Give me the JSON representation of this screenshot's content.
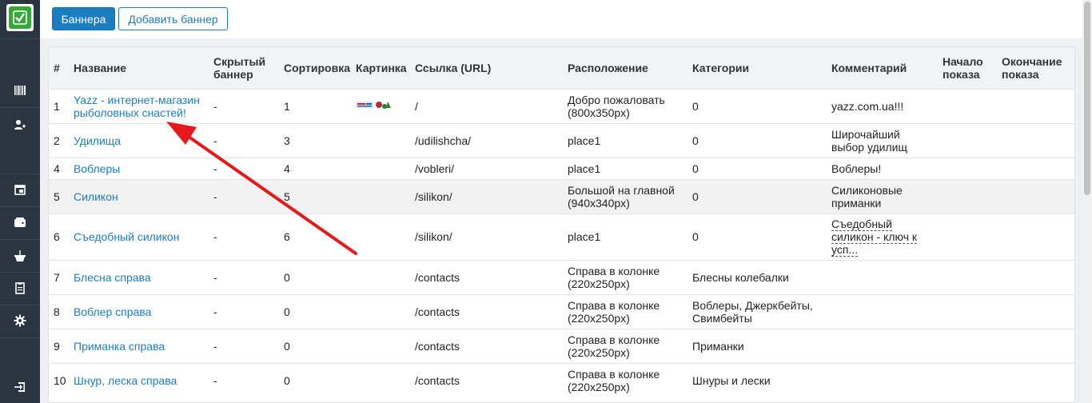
{
  "toolbar": {
    "banners_label": "Баннера",
    "add_banner_label": "Добавить баннер"
  },
  "sidebar": {
    "icons": [
      "check-logo-icon",
      "barcode-icon",
      "user-add-icon",
      "calendar-icon",
      "wallet-icon",
      "basket-icon",
      "clipboard-icon",
      "gear-icon",
      "logout-icon"
    ]
  },
  "table": {
    "headers": {
      "num": "#",
      "name": "Название",
      "hidden": "Скрытый баннер",
      "sort": "Сортировка",
      "image": "Картинка",
      "url": "Ссылка (URL)",
      "position": "Расположение",
      "categories": "Категории",
      "comment": "Комментарий",
      "start": "Начало показа",
      "end": "Окончание показа"
    },
    "rows": [
      {
        "num": "1",
        "name": "Yazz - интернет-магазин рыболовных снастей!",
        "hidden": "-",
        "sort": "1",
        "url": "/",
        "position": "Добро пожаловать (800x350px)",
        "categories": "0",
        "comment": "yazz.com.ua!!!"
      },
      {
        "num": "2",
        "name": "Удилища",
        "hidden": "-",
        "sort": "3",
        "url": "/udilishcha/",
        "position": "place1",
        "categories": "0",
        "comment": "Широчайший выбор удилищ"
      },
      {
        "num": "4",
        "name": "Воблеры",
        "hidden": "-",
        "sort": "4",
        "url": "/vobleri/",
        "position": "place1",
        "categories": "0",
        "comment": "Воблеры!"
      },
      {
        "num": "5",
        "name": "Силикон",
        "hidden": "-",
        "sort": "5",
        "url": "/silikon/",
        "position": "Большой на главной (940x340px)",
        "categories": "0",
        "comment": "Силиконовые приманки"
      },
      {
        "num": "6",
        "name": "Съедобный силикон",
        "hidden": "-",
        "sort": "6",
        "url": "/silikon/",
        "position": "place1",
        "categories": "0",
        "comment": "Съедобный силикон - ключ к усп..."
      },
      {
        "num": "7",
        "name": "Блесна справа",
        "hidden": "-",
        "sort": "0",
        "url": "/contacts",
        "position": "Справа в колонке (220x250px)",
        "categories": "Блесны колебалки",
        "comment": ""
      },
      {
        "num": "8",
        "name": "Воблер справа",
        "hidden": "-",
        "sort": "0",
        "url": "/contacts",
        "position": "Справа в колонке (220x250px)",
        "categories": "Воблеры, Джеркбейты, Свимбейты",
        "comment": ""
      },
      {
        "num": "9",
        "name": "Приманка справа",
        "hidden": "-",
        "sort": "0",
        "url": "/contacts",
        "position": "Справа в колонке (220x250px)",
        "categories": "Приманки",
        "comment": ""
      },
      {
        "num": "10",
        "name": "Шнур, леска справа",
        "hidden": "-",
        "sort": "0",
        "url": "/contacts",
        "position": "Справа в колонке (220x250px)",
        "categories": "Шнуры и лески",
        "comment": ""
      }
    ]
  },
  "colors": {
    "sidebar": "#2a3542",
    "accent": "#1b7ec1",
    "logo_green": "#36a838",
    "arrow": "#e8171a"
  }
}
